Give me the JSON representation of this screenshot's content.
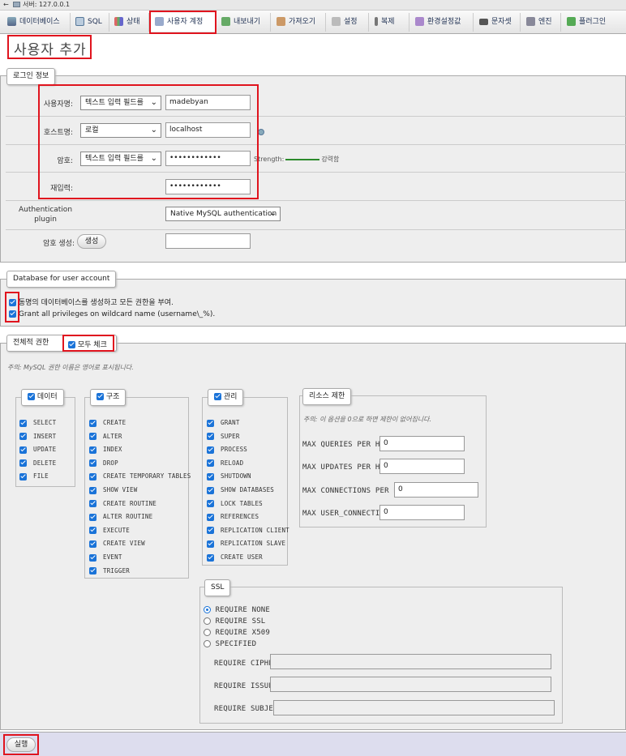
{
  "titlebar": {
    "server": "서버: 127.0.0.1"
  },
  "tabs": [
    {
      "label": "데이터베이스",
      "icon": "database-icon"
    },
    {
      "label": "SQL",
      "icon": "sql-icon"
    },
    {
      "label": "상태",
      "icon": "status-icon"
    },
    {
      "label": "사용자 계정",
      "icon": "users-icon"
    },
    {
      "label": "내보내기",
      "icon": "export-icon"
    },
    {
      "label": "가져오기",
      "icon": "import-icon"
    },
    {
      "label": "설정",
      "icon": "settings-icon"
    },
    {
      "label": "복제",
      "icon": "replication-icon"
    },
    {
      "label": "환경설정값",
      "icon": "variables-icon"
    },
    {
      "label": "문자셋",
      "icon": "charset-icon"
    },
    {
      "label": "엔진",
      "icon": "engine-icon"
    },
    {
      "label": "플러그인",
      "icon": "plugin-icon"
    }
  ],
  "page_title": "사용자 추가",
  "login": {
    "legend": "로그인 정보",
    "username_label": "사용자명:",
    "username_mode": "텍스트 입력 필드를",
    "username_value": "madebyan",
    "host_label": "호스트명:",
    "host_mode": "로컬",
    "host_value": "localhost",
    "password_label": "암호:",
    "password_mode": "텍스트 입력 필드를",
    "password_value": "••••••••••••",
    "strength_label": "Strength:",
    "strength_value": "강력함",
    "retype_label": "재입력:",
    "retype_value": "••••••••••••",
    "auth_label": "Authentication plugin",
    "auth_value": "Native MySQL authentication",
    "generate_label": "암호 생성:",
    "generate_button": "생성"
  },
  "database": {
    "legend": "Database for user account",
    "option1": "동명의 데이터베이스를 생성하고 모든 권한을 부여.",
    "option2": "Grant all privileges on wildcard name (username\\_%)."
  },
  "global": {
    "legend": "전체적 권한",
    "check_all": "모두 체크",
    "note": "주의: MySQL 권한 이름은 영어로 표시됩니다."
  },
  "groups": {
    "data": {
      "title": "데이터",
      "items": [
        "SELECT",
        "INSERT",
        "UPDATE",
        "DELETE",
        "FILE"
      ]
    },
    "structure": {
      "title": "구조",
      "items": [
        "CREATE",
        "ALTER",
        "INDEX",
        "DROP",
        "CREATE TEMPORARY TABLES",
        "SHOW VIEW",
        "CREATE ROUTINE",
        "ALTER ROUTINE",
        "EXECUTE",
        "CREATE VIEW",
        "EVENT",
        "TRIGGER"
      ]
    },
    "admin": {
      "title": "관리",
      "items": [
        "GRANT",
        "SUPER",
        "PROCESS",
        "RELOAD",
        "SHUTDOWN",
        "SHOW DATABASES",
        "LOCK TABLES",
        "REFERENCES",
        "REPLICATION CLIENT",
        "REPLICATION SLAVE",
        "CREATE USER"
      ]
    }
  },
  "resources": {
    "title": "리소스 제한",
    "note": "주의: 이 옵션을 0으로 하면 제한이 없어집니다.",
    "items": [
      {
        "label": "MAX QUERIES PER HOUR",
        "value": "0"
      },
      {
        "label": "MAX UPDATES PER HOUR",
        "value": "0"
      },
      {
        "label": "MAX CONNECTIONS PER HOUR",
        "value": "0"
      },
      {
        "label": "MAX USER_CONNECTIONS",
        "value": "0"
      }
    ]
  },
  "ssl": {
    "title": "SSL",
    "options": [
      "REQUIRE NONE",
      "REQUIRE SSL",
      "REQUIRE X509",
      "SPECIFIED"
    ],
    "selected": "REQUIRE NONE",
    "fields": [
      "REQUIRE CIPHER",
      "REQUIRE ISSUER",
      "REQUIRE SUBJECT"
    ]
  },
  "submit": "실행"
}
